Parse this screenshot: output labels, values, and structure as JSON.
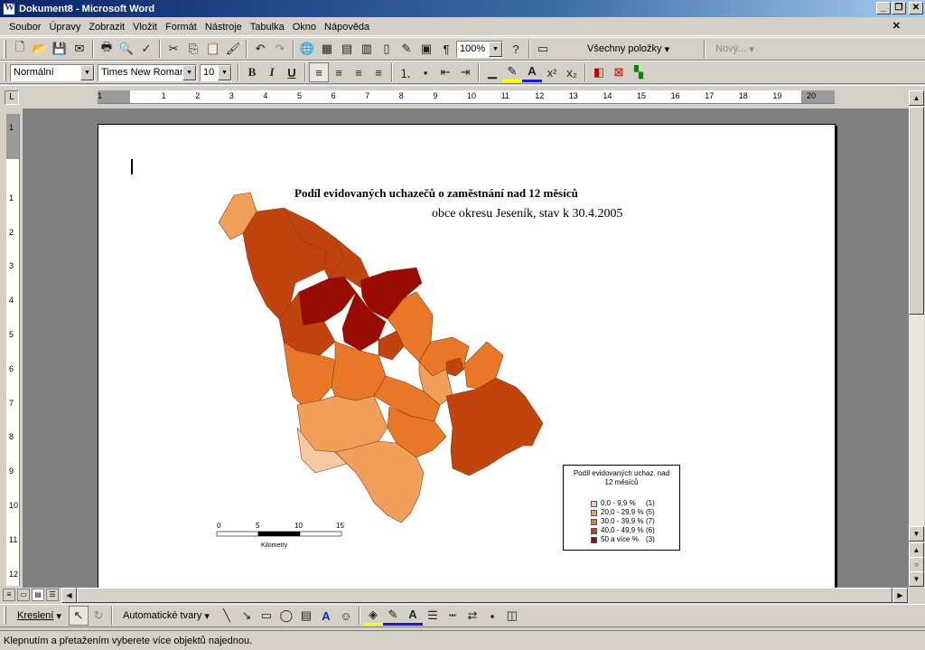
{
  "window": {
    "title": "Dokument8 - Microsoft Word"
  },
  "menu": [
    "Soubor",
    "Úpravy",
    "Zobrazit",
    "Vložit",
    "Formát",
    "Nástroje",
    "Tabulka",
    "Okno",
    "Nápověda"
  ],
  "toolbar_standard": {
    "zoom": "100%",
    "styles_button": "Všechny položky",
    "new_button": "Nový..."
  },
  "toolbar_format": {
    "style": "Normální",
    "font": "Times New Roman",
    "size": "10"
  },
  "ruler": {
    "horizontal": [
      "1",
      "1",
      "2",
      "3",
      "4",
      "5",
      "6",
      "7",
      "8",
      "9",
      "10",
      "11",
      "12",
      "13",
      "14",
      "15",
      "16",
      "17",
      "18",
      "19",
      "20"
    ],
    "vertical": [
      "1",
      "1",
      "2",
      "3",
      "4",
      "5",
      "6",
      "7",
      "8",
      "9",
      "10",
      "11",
      "12"
    ]
  },
  "document": {
    "map_title": "Podíl evidovaných uchazečů o zaměstnání nad 12 měsíců",
    "map_subtitle": "obce okresu Jeseník, stav k 30.4.2005",
    "legend": {
      "title": "Podíl evidovaných uchaz. nad 12 měsíců",
      "items": [
        {
          "label": "0,0 - 9,9 %",
          "count": "(1)",
          "color": "#f7c9a2"
        },
        {
          "label": "20,0 - 29,9 %",
          "count": "(5)",
          "color": "#f0a05a"
        },
        {
          "label": "30,0 - 39,9 %",
          "count": "(7)",
          "color": "#e87728"
        },
        {
          "label": "40,0 - 49,9 %",
          "count": "(6)",
          "color": "#c1440e"
        },
        {
          "label": "50 a více %",
          "count": "(3)",
          "color": "#980a02"
        }
      ]
    },
    "scale": {
      "ticks": [
        "0",
        "5",
        "10",
        "15"
      ],
      "unit": "Kilometry"
    }
  },
  "drawing_toolbar": {
    "draw": "Kreslení",
    "autoshapes": "Automatické tvary"
  },
  "status": "Klepnutím a přetažením vyberete více objektů najednou."
}
